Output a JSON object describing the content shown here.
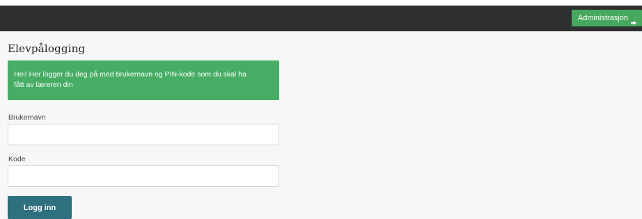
{
  "navbar": {
    "admin_label": "Administrasjon",
    "admin_icon": "arrow-right-icon"
  },
  "main": {
    "title": "Elevpålogging",
    "alert_text": "Hei! Her logger du deg på med brukernavn og PIN-kode som du skal ha fått av læreren din",
    "username_label": "Brukernavn",
    "username_value": "",
    "code_label": "Kode",
    "code_value": "",
    "login_label": "Logg inn"
  },
  "colors": {
    "navbar_bg": "#2f2f2f",
    "admin_button_bg": "#47a85f",
    "alert_bg": "#47ad64",
    "login_button_bg": "#2e6f80",
    "page_bg": "#f7f7f7"
  }
}
